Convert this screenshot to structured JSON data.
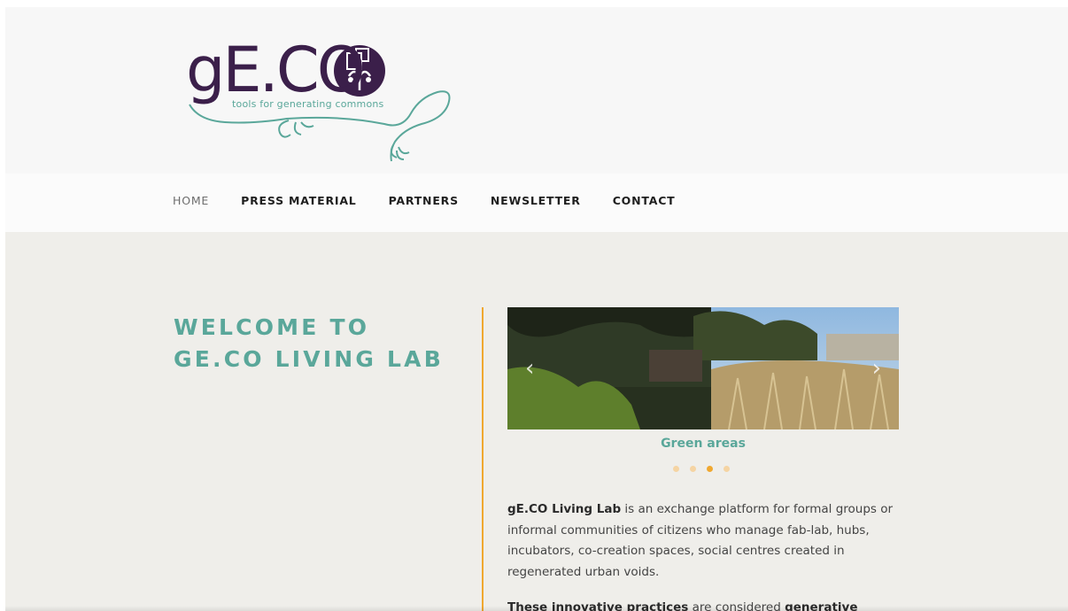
{
  "logo": {
    "word": "gE.CO",
    "tagline": "tools for generating commons"
  },
  "nav": {
    "items": [
      {
        "label": "HOME",
        "active": true
      },
      {
        "label": "PRESS MATERIAL",
        "active": false
      },
      {
        "label": "PARTNERS",
        "active": false
      },
      {
        "label": "NEWSLETTER",
        "active": false
      },
      {
        "label": "CONTACT",
        "active": false
      }
    ]
  },
  "hero": {
    "title_line1": "WELCOME TO",
    "title_line2": "GE.CO LIVING LAB"
  },
  "slider": {
    "caption": "Green areas",
    "prev_icon": "‹",
    "next_icon": "›",
    "slide_count": 4,
    "active_index": 2
  },
  "intro": {
    "p1_bold": "gE.CO Living Lab",
    "p1_rest": " is an exchange platform for formal groups or informal communities of citizens who manage fab-lab, hubs, incubators, co-creation spaces, social centres created in regenerated urban voids.",
    "p2_bold1": "These innovative practices",
    "p2_mid": " are considered ",
    "p2_bold2": "generative"
  },
  "colors": {
    "accent_teal": "#5aa79a",
    "accent_orange": "#f0a830",
    "logo_purple": "#3b1f4a"
  }
}
